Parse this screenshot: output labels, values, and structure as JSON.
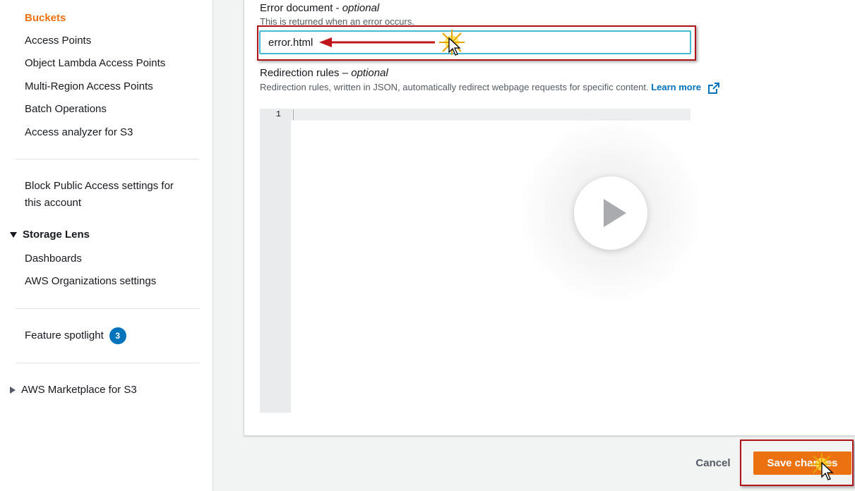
{
  "sidebar": {
    "items": [
      {
        "label": "Buckets",
        "active": true
      },
      {
        "label": "Access Points"
      },
      {
        "label": "Object Lambda Access Points"
      },
      {
        "label": "Multi-Region Access Points"
      },
      {
        "label": "Batch Operations"
      },
      {
        "label": "Access analyzer for S3"
      }
    ],
    "block_public_access": "Block Public Access settings for this account",
    "storage_lens": {
      "title": "Storage Lens",
      "expanded": true,
      "items": [
        {
          "label": "Dashboards"
        },
        {
          "label": "AWS Organizations settings"
        }
      ]
    },
    "feature_spotlight": {
      "label": "Feature spotlight",
      "count": "3"
    },
    "marketplace": {
      "label": "AWS Marketplace for S3",
      "expanded": false
    }
  },
  "form": {
    "error_document": {
      "label": "Error document - ",
      "optional": "optional",
      "description": "This is returned when an error occurs.",
      "value": "error.html"
    },
    "redirection_rules": {
      "label": "Redirection rules – ",
      "optional": "optional",
      "description": "Redirection rules, written in JSON, automatically redirect webpage requests for specific content. ",
      "learn_more": "Learn more",
      "line_number": "1"
    }
  },
  "footer": {
    "cancel_label": "Cancel",
    "save_label": "Save changes"
  },
  "colors": {
    "accent_orange": "#ec7211",
    "link_blue": "#0073bb",
    "highlight_red": "#b0141b",
    "focus_cyan": "#44b9d6"
  },
  "icons": [
    "external-link-icon",
    "play-icon",
    "cursor-icon",
    "triangle-down-icon",
    "triangle-right-icon"
  ]
}
